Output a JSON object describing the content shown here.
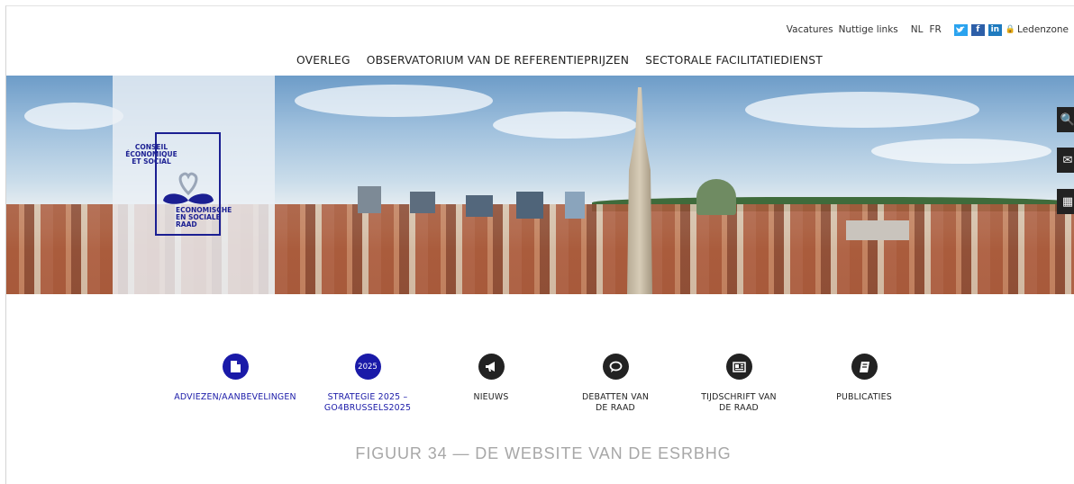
{
  "topbar": {
    "vacatures": "Vacatures",
    "links": "Nuttige links",
    "lang_nl": "NL",
    "lang_fr": "FR",
    "members": "Ledenzone"
  },
  "nav": [
    "OVERLEG",
    "OBSERVATORIUM VAN DE REFERENTIEPRIJZEN",
    "SECTORALE FACILITATIEDIENST"
  ],
  "logo": {
    "top": "CONSEIL ÉCONOMIQUE ET SOCIAL",
    "bottom": "ECONOMISCHE EN SOCIALE RAAD"
  },
  "tiles": [
    {
      "label": "ADVIEZEN/AANBEVELINGEN",
      "icon": "document-icon",
      "style": "blue"
    },
    {
      "label": "STRATEGIE 2025 – GO4BRUSSELS2025",
      "badge": "2025",
      "icon": "strategy-2025-icon",
      "style": "blue"
    },
    {
      "label": "NIEUWS",
      "icon": "megaphone-icon",
      "style": "dark"
    },
    {
      "label": "DEBATTEN VAN DE RAAD",
      "icon": "speech-bubble-icon",
      "style": "dark"
    },
    {
      "label": "TIJDSCHRIFT VAN DE RAAD",
      "icon": "newspaper-icon",
      "style": "dark"
    },
    {
      "label": "PUBLICATIES",
      "icon": "book-icon",
      "style": "dark"
    }
  ],
  "caption": "FIGUUR 34 — DE WEBSITE VAN DE ESRBHG",
  "colors": {
    "brand_blue": "#1a1aa8",
    "logo_blue": "#1b1f92",
    "twitter": "#2aa3ef",
    "facebook": "#2d5fa8",
    "linkedin": "#1f7bbf"
  }
}
